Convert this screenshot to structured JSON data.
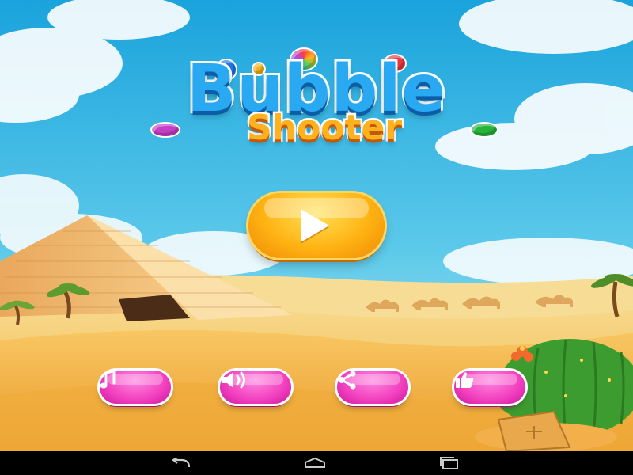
{
  "game": {
    "title_main": "Bubble",
    "title_sub": "Shooter"
  },
  "buttons": {
    "play": "play",
    "music": "music",
    "sound": "sound",
    "share": "share",
    "like": "like"
  },
  "navigation_bar": {
    "back": "back",
    "home": "home",
    "recents": "recent-apps"
  },
  "colors": {
    "sky_top": "#1aa3dc",
    "sky_bottom": "#9fe3f2",
    "sand": "#f6c55c",
    "play_button": "#ffb313",
    "menu_buttons": "#f23fbf",
    "title_blue": "#29a9f2",
    "title_orange": "#ffb21e"
  }
}
